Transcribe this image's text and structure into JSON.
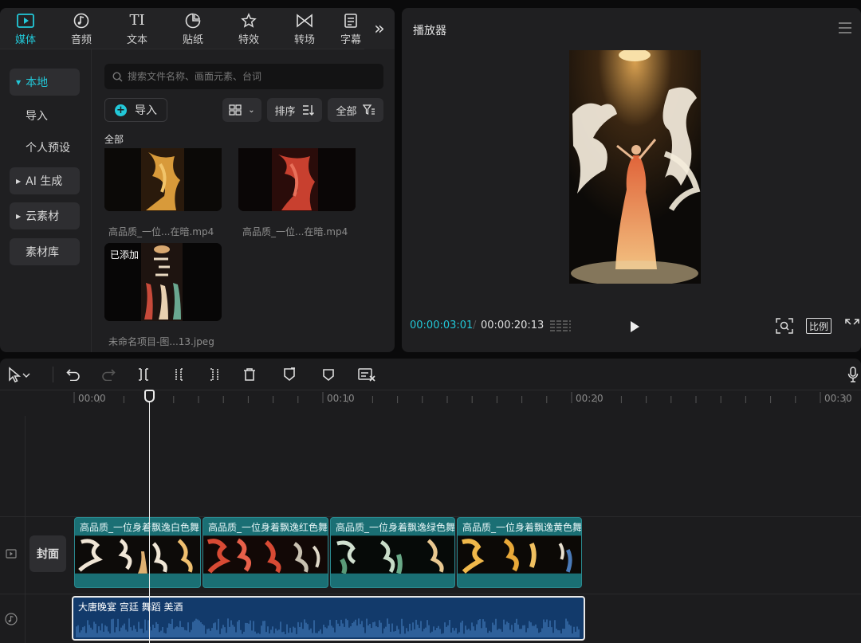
{
  "tabs": [
    {
      "label": "媒体",
      "icon": "media-icon"
    },
    {
      "label": "音频",
      "icon": "music-note-icon"
    },
    {
      "label": "文本",
      "icon": "text-icon"
    },
    {
      "label": "贴纸",
      "icon": "sticker-icon"
    },
    {
      "label": "特效",
      "icon": "effects-star-icon"
    },
    {
      "label": "转场",
      "icon": "transition-icon"
    },
    {
      "label": "字幕",
      "icon": "caption-icon"
    }
  ],
  "tabs_more": "»",
  "sidenav": {
    "local": "本地",
    "import": "导入",
    "presets": "个人预设",
    "ai": "AI 生成",
    "cloud": "云素材",
    "library": "素材库"
  },
  "media": {
    "search_placeholder": "搜索文件名称、画面元素、台词",
    "import_label": "导入",
    "sort_label": "排序",
    "filter_label": "全部",
    "group_label": "全部",
    "items": [
      {
        "caption": "高品质_一位...在暗.mp4"
      },
      {
        "caption": "高品质_一位...在暗.mp4"
      },
      {
        "caption": "未命名项目-图...13.jpeg",
        "badge": "已添加"
      }
    ]
  },
  "player": {
    "title": "播放器",
    "current_time": "00:00:03:01",
    "separator": "/",
    "total_time": "00:00:20:13",
    "ratio_label": "比例"
  },
  "timeline": {
    "ruler": [
      "00:00",
      "00:10",
      "00:20",
      "00:30"
    ],
    "cover_label": "封面",
    "clips": [
      {
        "label": "高品质_一位身着飘逸白色舞"
      },
      {
        "label": "高品质_一位身着飘逸红色舞"
      },
      {
        "label": "高品质_一位身着飘逸绿色舞"
      },
      {
        "label": "高品质_一位身着飘逸黄色舞"
      }
    ],
    "audio_label": "大唐晚宴 宫廷 舞蹈 美酒"
  },
  "colors": {
    "accent": "#22c8d8",
    "clip": "#1a6f74",
    "audio": "#123a6b"
  }
}
